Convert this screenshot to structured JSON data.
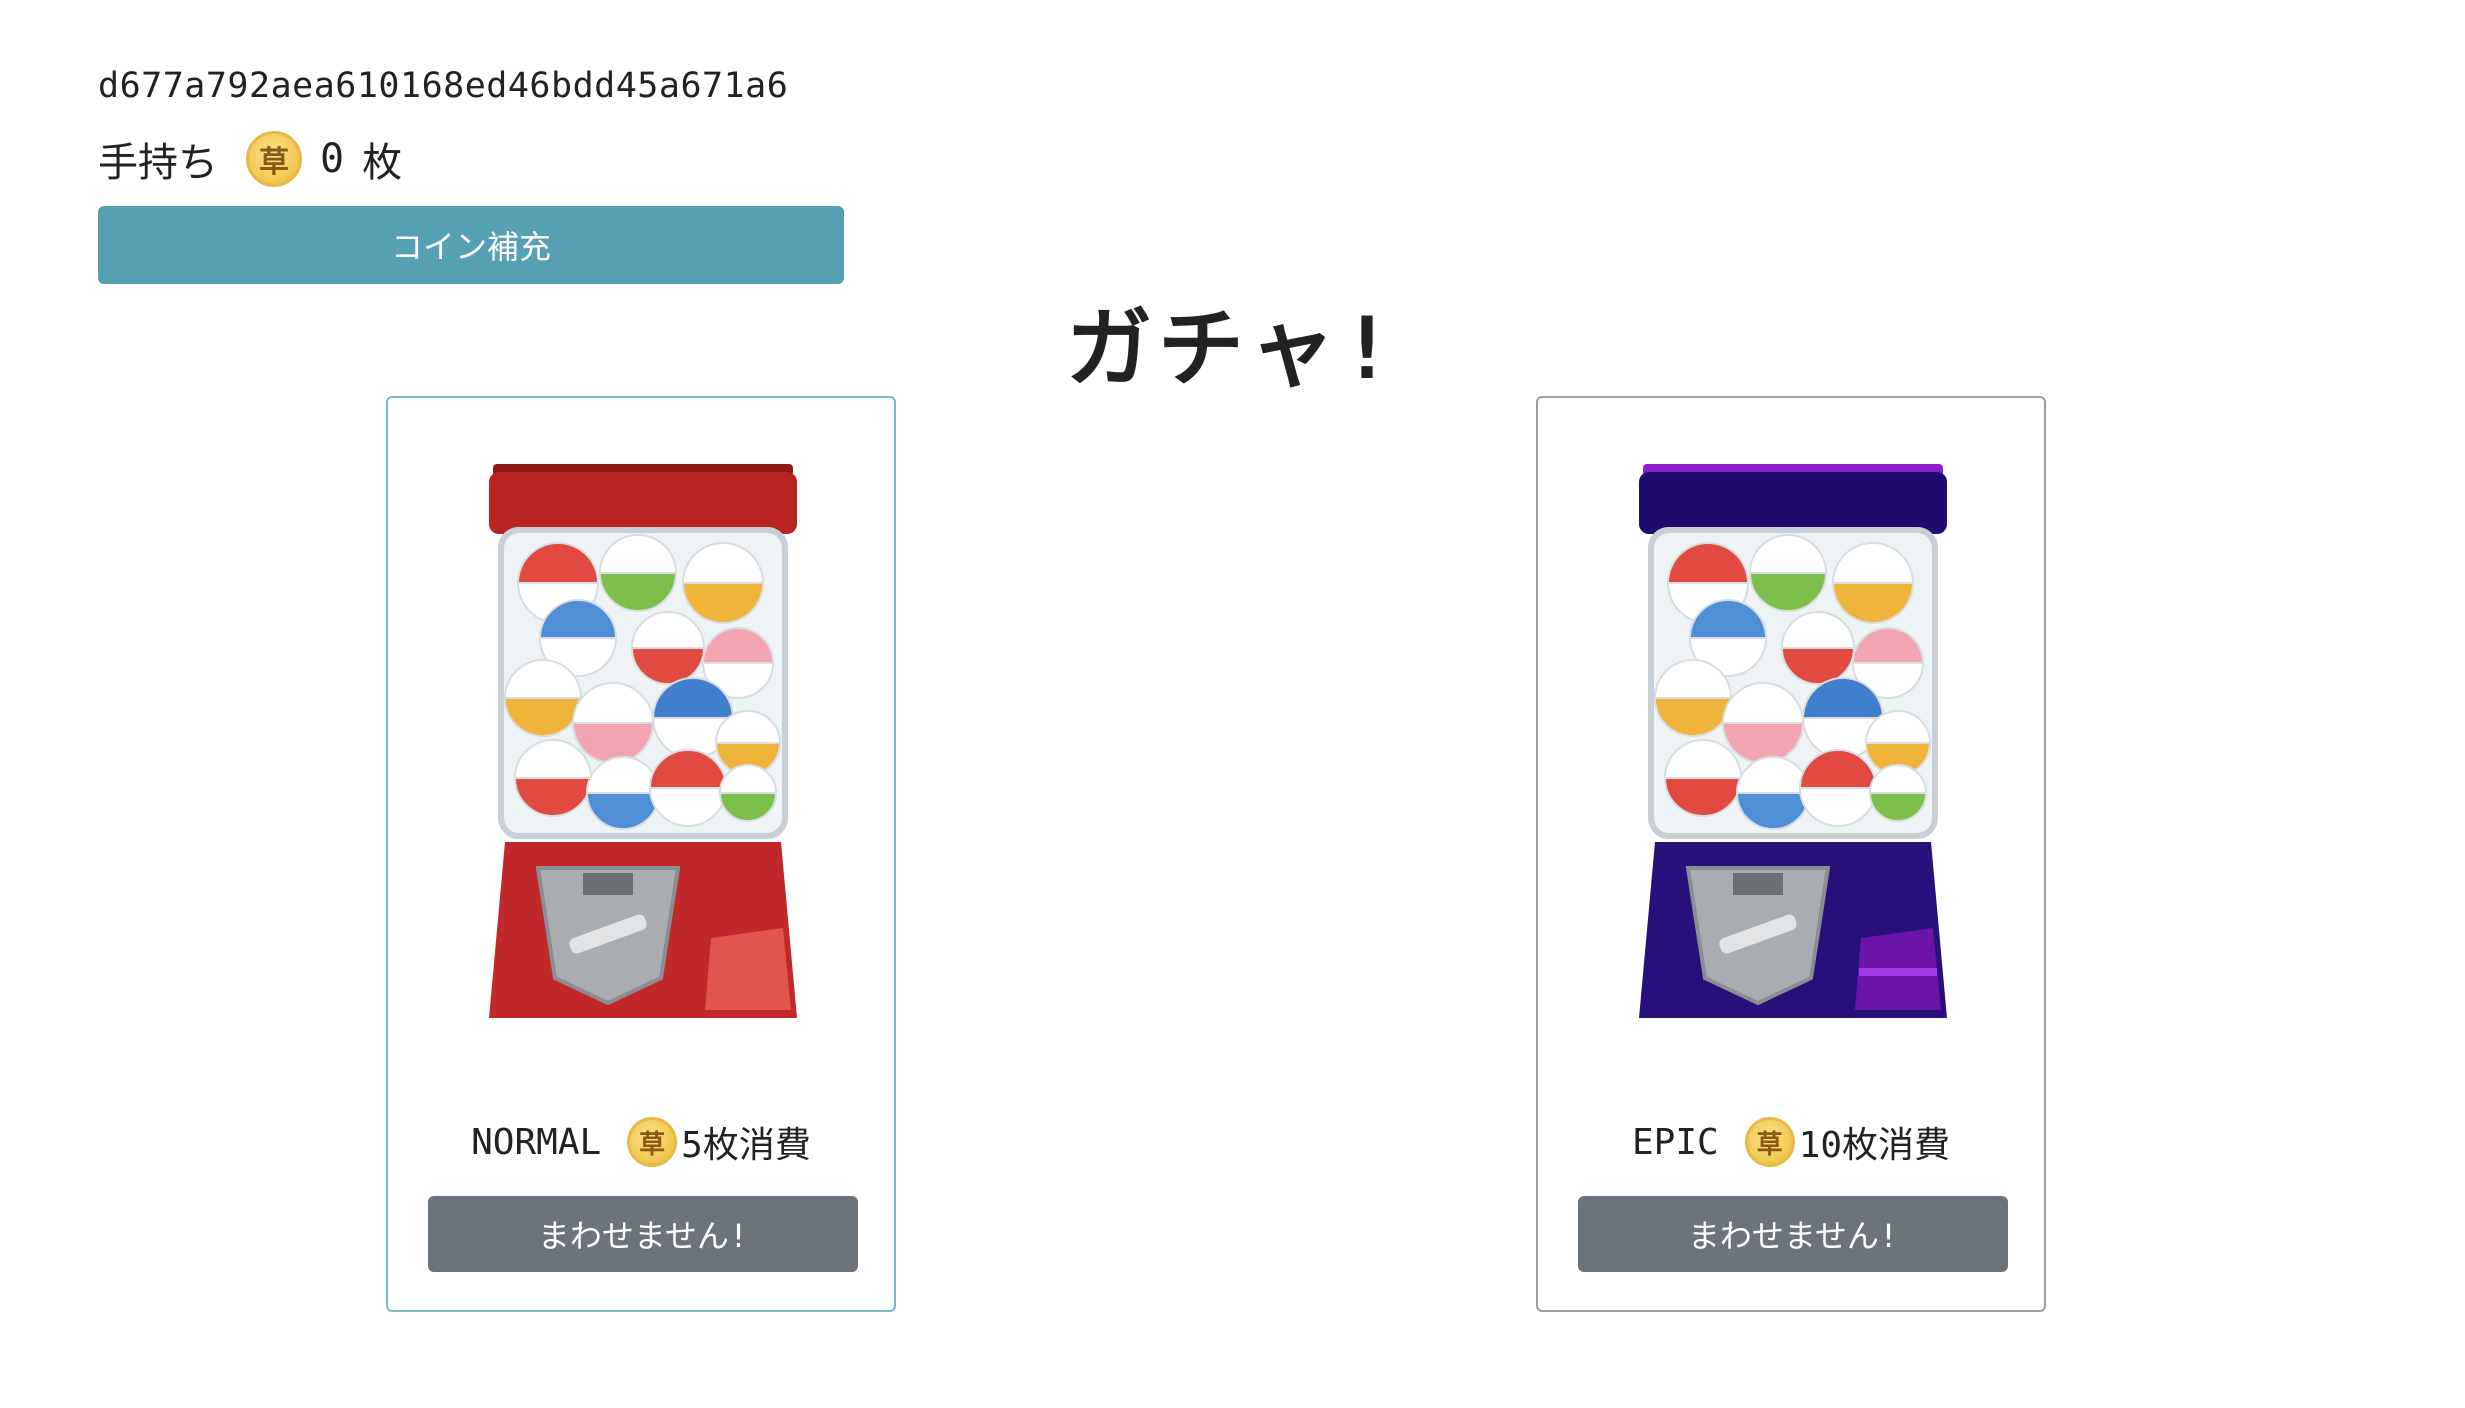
{
  "user": {
    "id": "d677a792aea610168ed46bdd45a671a6"
  },
  "wallet": {
    "label": "手持ち",
    "coin_symbol": "草",
    "count": "0",
    "unit": "枚"
  },
  "refill_button": {
    "label": "コイン補充"
  },
  "page_title": "ガチャ!",
  "gachas": [
    {
      "rarity": "NORMAL",
      "coin_symbol": "草",
      "cost": "5枚消費",
      "button_label": "まわせません!",
      "colors": {
        "body": "#c0282a",
        "cap": "#b82422",
        "accent": "#e0564d"
      }
    },
    {
      "rarity": "EPIC",
      "coin_symbol": "草",
      "cost": "10枚消費",
      "button_label": "まわせません!",
      "colors": {
        "body": "#27107a",
        "cap": "#1f0a6e",
        "accent": "#8a1fd0"
      }
    }
  ],
  "colors": {
    "refill": "#56a0b4",
    "disabled_button": "#6c737a",
    "normal_border": "#7cb9c5",
    "epic_border": "#9c9c9c"
  }
}
